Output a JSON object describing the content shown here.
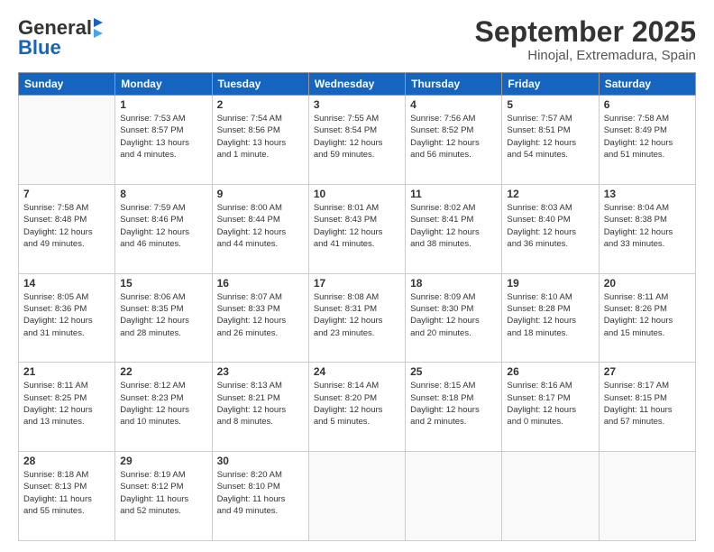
{
  "header": {
    "logo_general": "General",
    "logo_blue": "Blue",
    "month": "September 2025",
    "location": "Hinojal, Extremadura, Spain"
  },
  "weekdays": [
    "Sunday",
    "Monday",
    "Tuesday",
    "Wednesday",
    "Thursday",
    "Friday",
    "Saturday"
  ],
  "weeks": [
    [
      {
        "day": "",
        "info": ""
      },
      {
        "day": "1",
        "info": "Sunrise: 7:53 AM\nSunset: 8:57 PM\nDaylight: 13 hours\nand 4 minutes."
      },
      {
        "day": "2",
        "info": "Sunrise: 7:54 AM\nSunset: 8:56 PM\nDaylight: 13 hours\nand 1 minute."
      },
      {
        "day": "3",
        "info": "Sunrise: 7:55 AM\nSunset: 8:54 PM\nDaylight: 12 hours\nand 59 minutes."
      },
      {
        "day": "4",
        "info": "Sunrise: 7:56 AM\nSunset: 8:52 PM\nDaylight: 12 hours\nand 56 minutes."
      },
      {
        "day": "5",
        "info": "Sunrise: 7:57 AM\nSunset: 8:51 PM\nDaylight: 12 hours\nand 54 minutes."
      },
      {
        "day": "6",
        "info": "Sunrise: 7:58 AM\nSunset: 8:49 PM\nDaylight: 12 hours\nand 51 minutes."
      }
    ],
    [
      {
        "day": "7",
        "info": "Sunrise: 7:58 AM\nSunset: 8:48 PM\nDaylight: 12 hours\nand 49 minutes."
      },
      {
        "day": "8",
        "info": "Sunrise: 7:59 AM\nSunset: 8:46 PM\nDaylight: 12 hours\nand 46 minutes."
      },
      {
        "day": "9",
        "info": "Sunrise: 8:00 AM\nSunset: 8:44 PM\nDaylight: 12 hours\nand 44 minutes."
      },
      {
        "day": "10",
        "info": "Sunrise: 8:01 AM\nSunset: 8:43 PM\nDaylight: 12 hours\nand 41 minutes."
      },
      {
        "day": "11",
        "info": "Sunrise: 8:02 AM\nSunset: 8:41 PM\nDaylight: 12 hours\nand 38 minutes."
      },
      {
        "day": "12",
        "info": "Sunrise: 8:03 AM\nSunset: 8:40 PM\nDaylight: 12 hours\nand 36 minutes."
      },
      {
        "day": "13",
        "info": "Sunrise: 8:04 AM\nSunset: 8:38 PM\nDaylight: 12 hours\nand 33 minutes."
      }
    ],
    [
      {
        "day": "14",
        "info": "Sunrise: 8:05 AM\nSunset: 8:36 PM\nDaylight: 12 hours\nand 31 minutes."
      },
      {
        "day": "15",
        "info": "Sunrise: 8:06 AM\nSunset: 8:35 PM\nDaylight: 12 hours\nand 28 minutes."
      },
      {
        "day": "16",
        "info": "Sunrise: 8:07 AM\nSunset: 8:33 PM\nDaylight: 12 hours\nand 26 minutes."
      },
      {
        "day": "17",
        "info": "Sunrise: 8:08 AM\nSunset: 8:31 PM\nDaylight: 12 hours\nand 23 minutes."
      },
      {
        "day": "18",
        "info": "Sunrise: 8:09 AM\nSunset: 8:30 PM\nDaylight: 12 hours\nand 20 minutes."
      },
      {
        "day": "19",
        "info": "Sunrise: 8:10 AM\nSunset: 8:28 PM\nDaylight: 12 hours\nand 18 minutes."
      },
      {
        "day": "20",
        "info": "Sunrise: 8:11 AM\nSunset: 8:26 PM\nDaylight: 12 hours\nand 15 minutes."
      }
    ],
    [
      {
        "day": "21",
        "info": "Sunrise: 8:11 AM\nSunset: 8:25 PM\nDaylight: 12 hours\nand 13 minutes."
      },
      {
        "day": "22",
        "info": "Sunrise: 8:12 AM\nSunset: 8:23 PM\nDaylight: 12 hours\nand 10 minutes."
      },
      {
        "day": "23",
        "info": "Sunrise: 8:13 AM\nSunset: 8:21 PM\nDaylight: 12 hours\nand 8 minutes."
      },
      {
        "day": "24",
        "info": "Sunrise: 8:14 AM\nSunset: 8:20 PM\nDaylight: 12 hours\nand 5 minutes."
      },
      {
        "day": "25",
        "info": "Sunrise: 8:15 AM\nSunset: 8:18 PM\nDaylight: 12 hours\nand 2 minutes."
      },
      {
        "day": "26",
        "info": "Sunrise: 8:16 AM\nSunset: 8:17 PM\nDaylight: 12 hours\nand 0 minutes."
      },
      {
        "day": "27",
        "info": "Sunrise: 8:17 AM\nSunset: 8:15 PM\nDaylight: 11 hours\nand 57 minutes."
      }
    ],
    [
      {
        "day": "28",
        "info": "Sunrise: 8:18 AM\nSunset: 8:13 PM\nDaylight: 11 hours\nand 55 minutes."
      },
      {
        "day": "29",
        "info": "Sunrise: 8:19 AM\nSunset: 8:12 PM\nDaylight: 11 hours\nand 52 minutes."
      },
      {
        "day": "30",
        "info": "Sunrise: 8:20 AM\nSunset: 8:10 PM\nDaylight: 11 hours\nand 49 minutes."
      },
      {
        "day": "",
        "info": ""
      },
      {
        "day": "",
        "info": ""
      },
      {
        "day": "",
        "info": ""
      },
      {
        "day": "",
        "info": ""
      }
    ]
  ]
}
